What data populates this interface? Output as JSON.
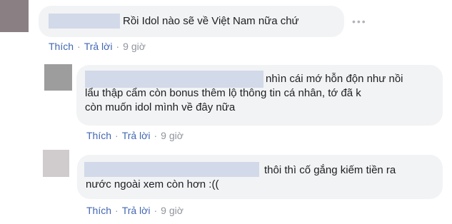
{
  "colors": {
    "bubble_bg": "#f2f3f5",
    "link": "#4267b2",
    "meta_text": "#90949c",
    "name_redaction": "#d2d9e8"
  },
  "comments": [
    {
      "text": "Rồi Idol nào sẽ về Việt Nam nữa chứ",
      "actions": {
        "like": "Thích",
        "reply": "Trả lời",
        "time": "9 giờ"
      },
      "more_icon": "more-horizontal-icon"
    },
    {
      "text": "nhìn cái mớ hỗn độn như nồi\nlẩu thập cẩm còn bonus thêm lộ thông tin cá nhân, tớ đã k\ncòn muốn idol mình về đây nữa",
      "actions": {
        "like": "Thích",
        "reply": "Trả lời",
        "time": "9 giờ"
      }
    },
    {
      "text": "thôi thì cố gắng kiếm tiền ra\nnước ngoài xem còn hơn :((",
      "actions": {
        "like": "Thích",
        "reply": "Trả lời",
        "time": "9 giờ"
      }
    }
  ]
}
